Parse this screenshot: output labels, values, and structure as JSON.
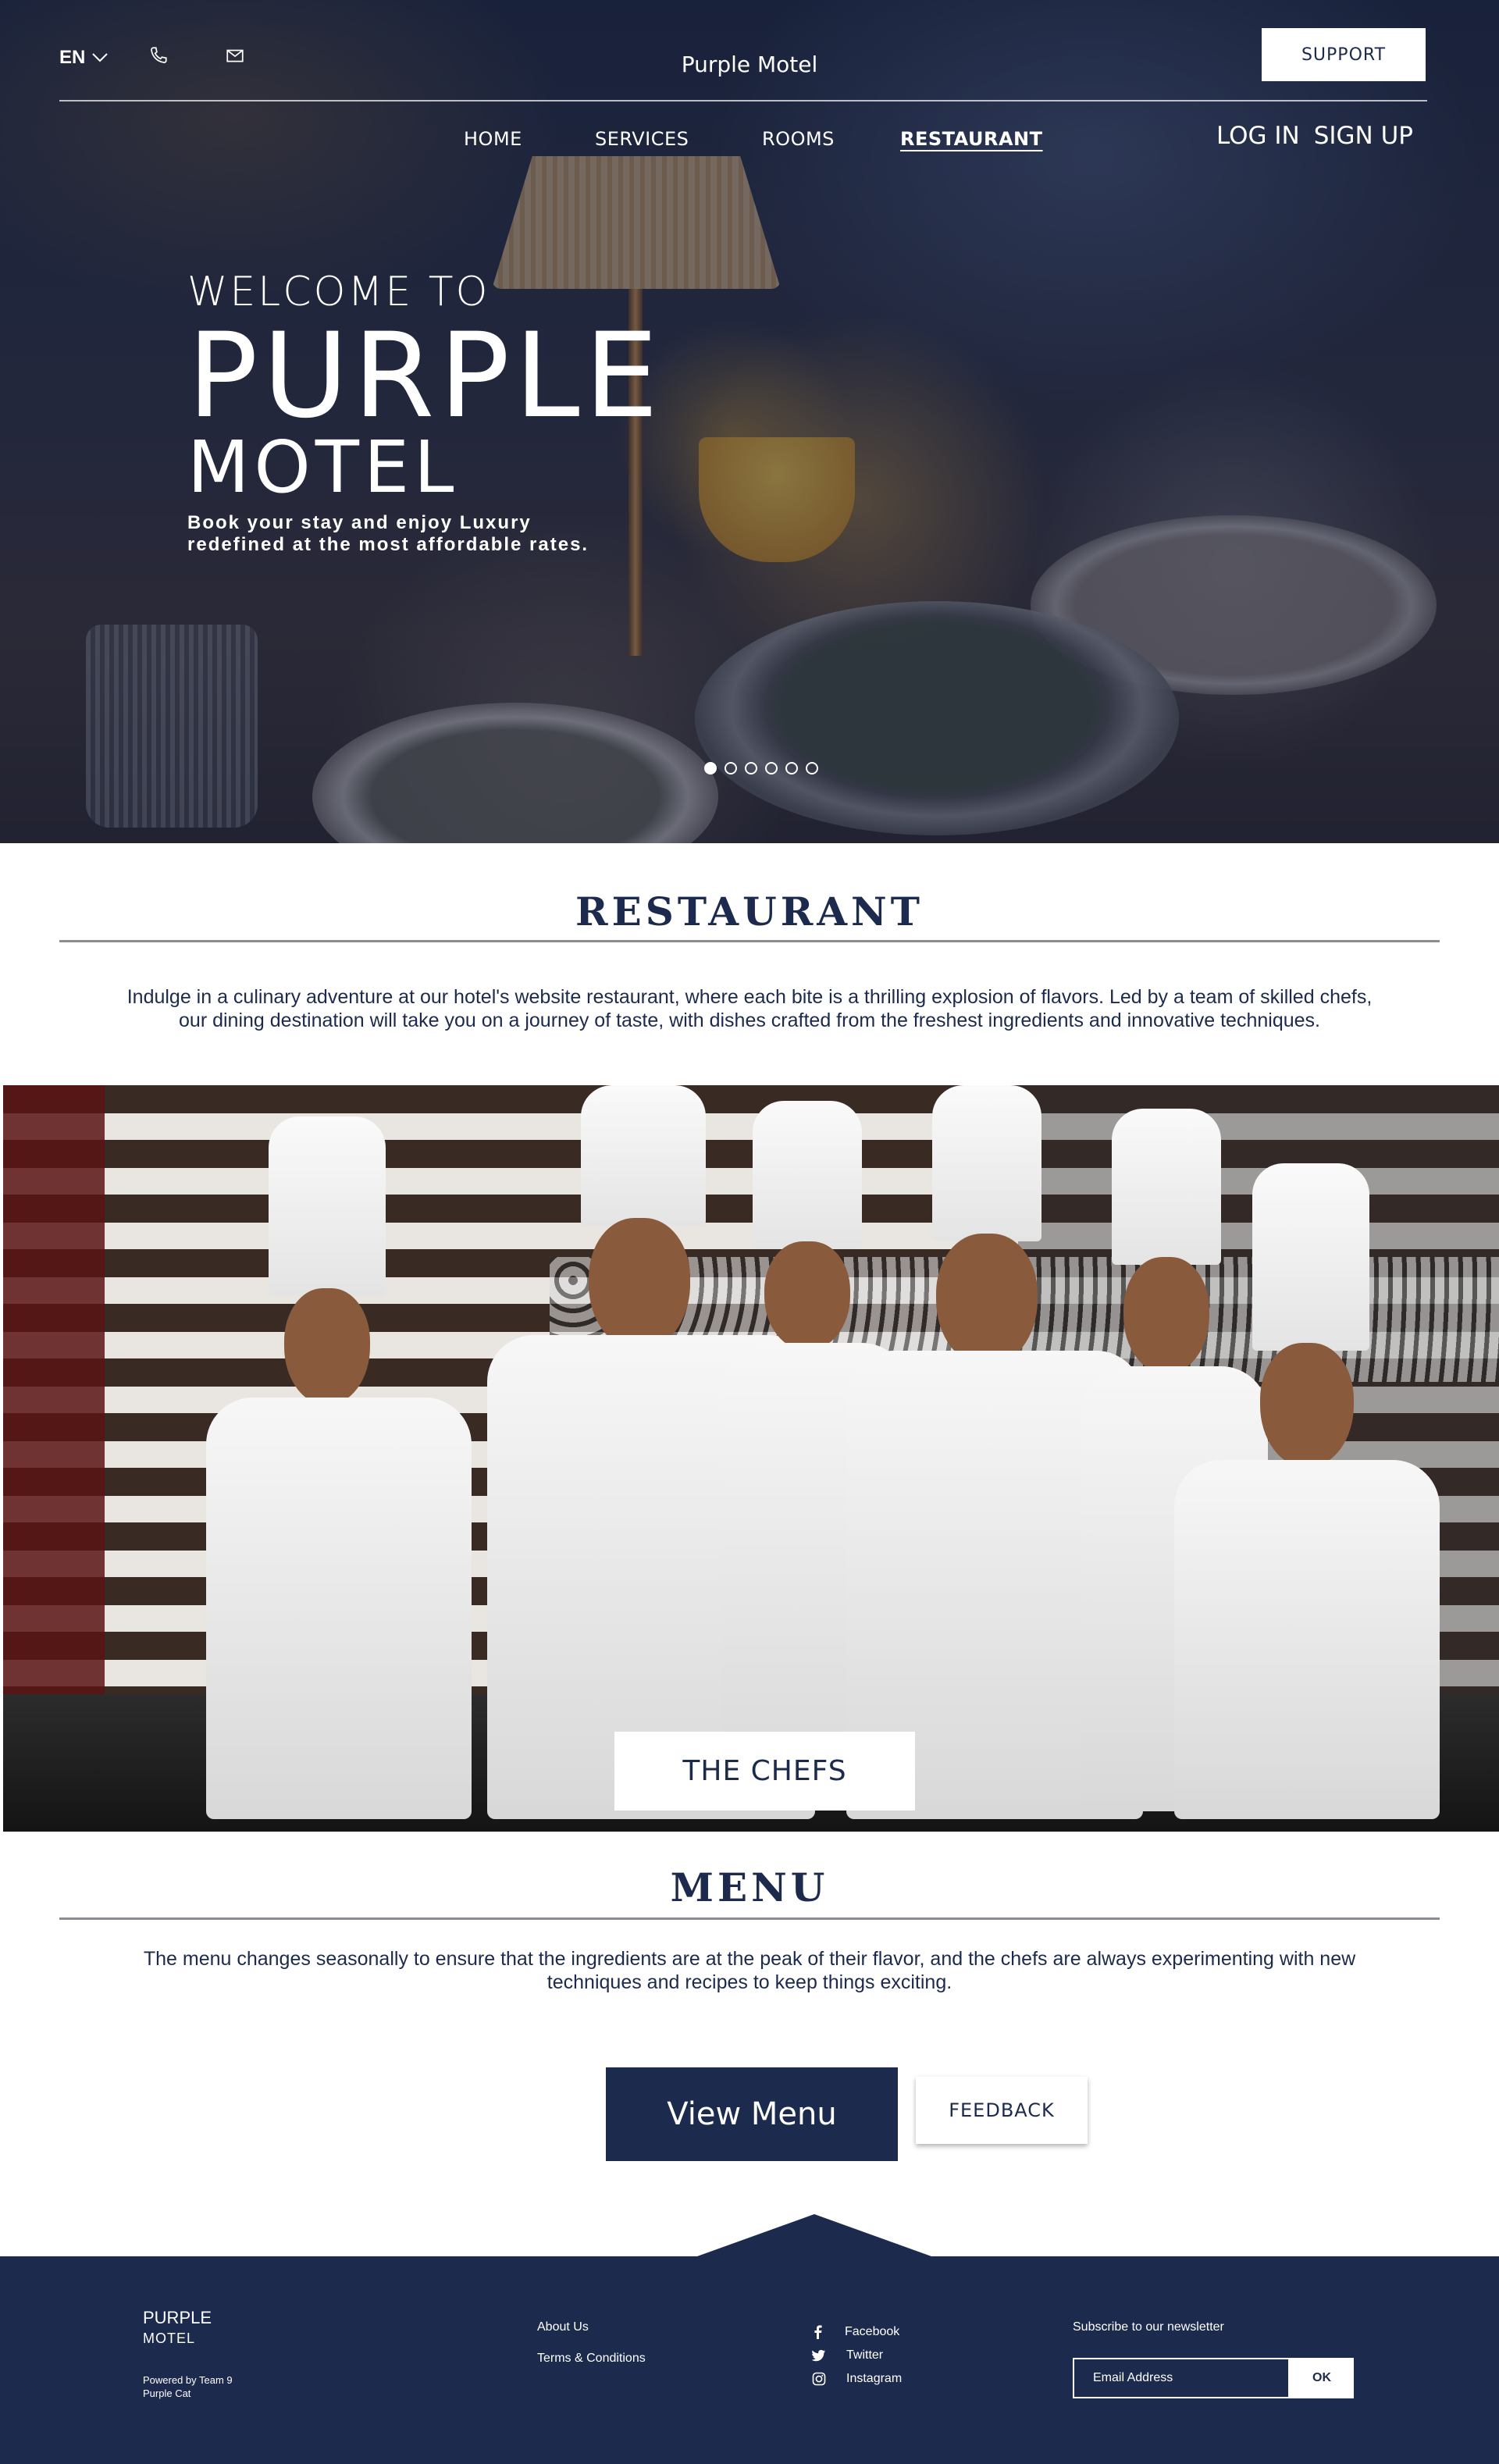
{
  "header": {
    "language": "EN",
    "brand": "Purple Motel",
    "support_label": "SUPPORT",
    "nav": [
      {
        "label": "HOME"
      },
      {
        "label": "SERVICES"
      },
      {
        "label": "ROOMS"
      },
      {
        "label": "RESTAURANT",
        "active": true
      }
    ],
    "login_label": "LOG IN",
    "signup_label": "SIGN UP"
  },
  "hero": {
    "welcome": "WELCOME TO",
    "title": "PURPLE",
    "subtitle": "MOTEL",
    "tagline": "Book your stay and enjoy Luxury redefined at the most affordable rates.",
    "slides_total": 6,
    "slide_active": 1
  },
  "restaurant": {
    "title": "RESTAURANT",
    "description": "Indulge in a culinary adventure at our hotel's website restaurant, where each bite is a thrilling explosion of flavors. Led by a team of skilled chefs, our dining destination will take you on a journey of taste, with dishes crafted from the freshest ingredients and innovative techniques.",
    "chefs_label": "THE CHEFS"
  },
  "menu": {
    "title": "MENU",
    "description": "The menu changes seasonally to ensure that the ingredients are at the peak of their flavor, and the chefs are always experimenting with new techniques and recipes to keep things exciting.",
    "view_menu_label": "View Menu",
    "feedback_label": "FEEDBACK"
  },
  "footer": {
    "brand_line1": "PURPLE",
    "brand_line2": "MOTEL",
    "powered_line1": "Powered by Team 9",
    "powered_line2": "Purple Cat",
    "links": [
      {
        "label": "About Us"
      },
      {
        "label": "Terms & Conditions"
      }
    ],
    "social": [
      {
        "label": "Facebook",
        "icon": "facebook-icon"
      },
      {
        "label": "Twitter",
        "icon": "twitter-icon"
      },
      {
        "label": "Instagram",
        "icon": "instagram-icon"
      }
    ],
    "newsletter_title": "Subscribe to our newsletter",
    "email_placeholder": "Email Address",
    "ok_label": "OK"
  },
  "colors": {
    "primary": "#1c2a4d",
    "white": "#ffffff"
  }
}
